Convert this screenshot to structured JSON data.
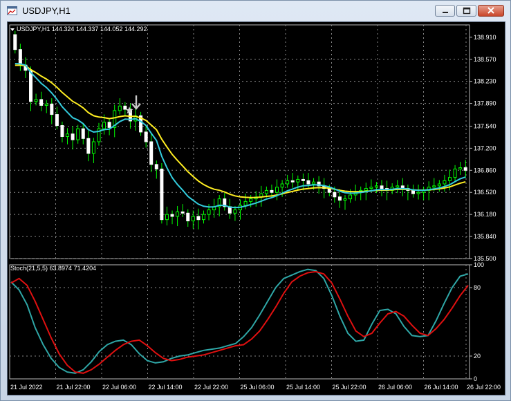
{
  "window": {
    "title": "USDJPY,H1",
    "icon": "chart-window-icon",
    "buttons": [
      "minimize-icon",
      "maximize-icon",
      "close-icon"
    ]
  },
  "colors": {
    "background": "#000000",
    "grid": "#8a8a8a",
    "candle": "#ffffff",
    "wick": "#00ff00",
    "ma_fast": "#33ccdd",
    "ma_slow": "#ffee22",
    "stoch_main": "#2fa7a7",
    "stoch_signal": "#e01010",
    "text": "#ffffff"
  },
  "main_panel": {
    "header": "USDJPY,H1  144.324 144.337 144.052 144.292"
  },
  "stoch_panel": {
    "header": "Stoch(21,5,5) 63.8974 71.4204"
  },
  "chart_data": [
    {
      "type": "candlestick",
      "title": "USDJPY,H1  144.324 144.337 144.052 144.292",
      "ylim": [
        135.5,
        139.1
      ],
      "yticks": [
        "138.910",
        "138.570",
        "138.230",
        "137.890",
        "137.540",
        "137.200",
        "136.860",
        "136.520",
        "136.180",
        "135.840",
        "135.500"
      ],
      "xticks": [
        "21 Jul 2022",
        "21 Jul 22:00",
        "22 Jul 06:00",
        "22 Jul 14:00",
        "22 Jul 22:00",
        "25 Jul 06:00",
        "25 Jul 14:00",
        "25 Jul 22:00",
        "26 Jul 06:00",
        "26 Jul 14:00",
        "26 Jul 22:00"
      ],
      "grid": true,
      "close": [
        138.72,
        138.48,
        138.4,
        137.92,
        137.95,
        137.86,
        137.88,
        137.72,
        137.55,
        137.38,
        137.42,
        137.33,
        137.5,
        137.35,
        137.12,
        137.3,
        137.5,
        137.6,
        137.52,
        137.78,
        137.85,
        137.8,
        137.62,
        137.7,
        137.45,
        137.3,
        136.95,
        136.88,
        136.1,
        136.18,
        136.15,
        136.22,
        136.2,
        136.08,
        136.15,
        136.1,
        136.18,
        136.25,
        136.3,
        136.42,
        136.3,
        136.2,
        136.25,
        136.32,
        136.38,
        136.42,
        136.45,
        136.5,
        136.55,
        136.52,
        136.6,
        136.65,
        136.7,
        136.68,
        136.72,
        136.7,
        136.65,
        136.68,
        136.62,
        136.58,
        136.52,
        136.45,
        136.4,
        136.42,
        136.48,
        136.52,
        136.55,
        136.58,
        136.6,
        136.62,
        136.58,
        136.55,
        136.6,
        136.62,
        136.58,
        136.55,
        136.5,
        136.52,
        136.55,
        136.6,
        136.62,
        136.65,
        136.7,
        136.75,
        136.88,
        136.9,
        136.86
      ]
    },
    {
      "type": "line",
      "title": "Stoch(21,5,5) 63.8974 71.4204",
      "ylim": [
        0,
        100
      ],
      "yticks": [
        "100",
        "80",
        "20",
        "0"
      ],
      "levels": [
        20,
        80
      ],
      "series": [
        {
          "values": [
            85,
            78,
            65,
            45,
            30,
            18,
            10,
            6,
            5,
            8,
            15,
            24,
            30,
            33,
            34,
            30,
            22,
            16,
            14,
            15,
            18,
            20,
            21,
            23,
            25,
            26,
            27,
            29,
            31,
            37,
            45,
            56,
            68,
            80,
            88,
            91,
            94,
            96,
            95,
            88,
            73,
            55,
            40,
            33,
            34,
            48,
            60,
            61,
            57,
            46,
            38,
            37,
            38,
            51,
            66,
            80,
            90,
            92
          ]
        },
        {
          "values": [
            84,
            88,
            82,
            68,
            52,
            36,
            22,
            12,
            6,
            5,
            8,
            13,
            19,
            25,
            30,
            33,
            34,
            29,
            23,
            18,
            16,
            17,
            19,
            20,
            21,
            23,
            25,
            27,
            29,
            30,
            35,
            42,
            52,
            63,
            75,
            85,
            90,
            93,
            94,
            92,
            84,
            70,
            55,
            42,
            37,
            40,
            49,
            57,
            59,
            55,
            47,
            40,
            38,
            44,
            52,
            62,
            73,
            82
          ]
        }
      ]
    }
  ]
}
